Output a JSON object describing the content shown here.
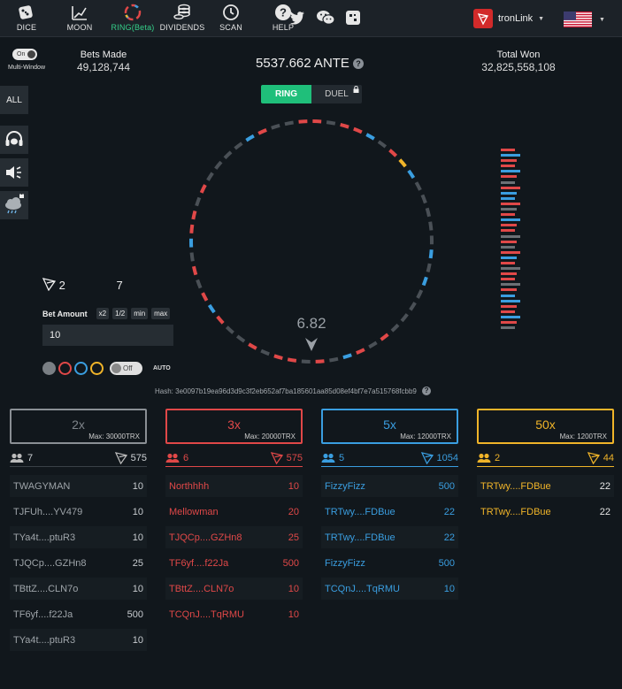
{
  "nav": {
    "items": [
      {
        "label": "DICE",
        "icon": "dice-icon"
      },
      {
        "label": "MOON",
        "icon": "moon-chart-icon"
      },
      {
        "label": "RING(Beta)",
        "icon": "ring-icon"
      },
      {
        "label": "DIVIDENDS",
        "icon": "coins-icon"
      },
      {
        "label": "SCAN",
        "icon": "history-icon"
      },
      {
        "label": "HELP",
        "icon": "help-icon"
      }
    ],
    "wallet_label": "tronLink",
    "social": [
      "twitter-icon",
      "wechat-icon",
      "discord-icon"
    ]
  },
  "multi_window": {
    "toggle_label": "On",
    "label": "Multi-Window"
  },
  "side_buttons": {
    "all_label": "ALL"
  },
  "stats": {
    "bets_made_title": "Bets Made",
    "bets_made_value": "49,128,744",
    "total_won_title": "Total Won",
    "total_won_value": "32,825,558,108",
    "balance": "5537.662 ANTE"
  },
  "modes": {
    "ring": "RING",
    "duel": "DUEL"
  },
  "wheel": {
    "value": "6.82"
  },
  "bet": {
    "players": "2",
    "amount_count": "7",
    "label": "Bet Amount",
    "chips": [
      "x2",
      "1/2",
      "min",
      "max"
    ],
    "value": "10",
    "auto_toggle": "Off",
    "auto_label": "AUTO"
  },
  "hash": "Hash: 3e0097b19ea96d3d9c3f2eb652af7ba185601aa85d08ef4bf7e7a515768fcbb9",
  "colors": {
    "gray": "#7a7f84",
    "red": "#e04848",
    "blue": "#3a9ee0",
    "gold": "#f0b429"
  },
  "columns": [
    {
      "mult": "2x",
      "max": "Max: 30000TRX",
      "players": "7",
      "total": "575",
      "rows": [
        {
          "name": "TWAGYMAN",
          "amount": "10"
        },
        {
          "name": "TJFUh....YV479",
          "amount": "10"
        },
        {
          "name": "TYa4t....ptuR3",
          "amount": "10"
        },
        {
          "name": "TJQCp....GZHn8",
          "amount": "25"
        },
        {
          "name": "TBttZ....CLN7o",
          "amount": "10"
        },
        {
          "name": "TF6yf....f22Ja",
          "amount": "500"
        },
        {
          "name": "TYa4t....ptuR3",
          "amount": "10"
        }
      ]
    },
    {
      "mult": "3x",
      "max": "Max: 20000TRX",
      "players": "6",
      "total": "575",
      "rows": [
        {
          "name": "Northhhh",
          "amount": "10"
        },
        {
          "name": "Mellowman",
          "amount": "20"
        },
        {
          "name": "TJQCp....GZHn8",
          "amount": "25"
        },
        {
          "name": "TF6yf....f22Ja",
          "amount": "500"
        },
        {
          "name": "TBttZ....CLN7o",
          "amount": "10"
        },
        {
          "name": "TCQnJ....TqRMU",
          "amount": "10"
        }
      ]
    },
    {
      "mult": "5x",
      "max": "Max: 12000TRX",
      "players": "5",
      "total": "1054",
      "rows": [
        {
          "name": "FizzyFizz",
          "amount": "500"
        },
        {
          "name": "TRTwy....FDBue",
          "amount": "22"
        },
        {
          "name": "TRTwy....FDBue",
          "amount": "22"
        },
        {
          "name": "FizzyFizz",
          "amount": "500"
        },
        {
          "name": "TCQnJ....TqRMU",
          "amount": "10"
        }
      ]
    },
    {
      "mult": "50x",
      "max": "Max: 1200TRX",
      "players": "2",
      "total": "44",
      "rows": [
        {
          "name": "TRTwy....FDBue",
          "amount": "22"
        },
        {
          "name": "TRTwy....FDBue",
          "amount": "22"
        }
      ]
    }
  ]
}
